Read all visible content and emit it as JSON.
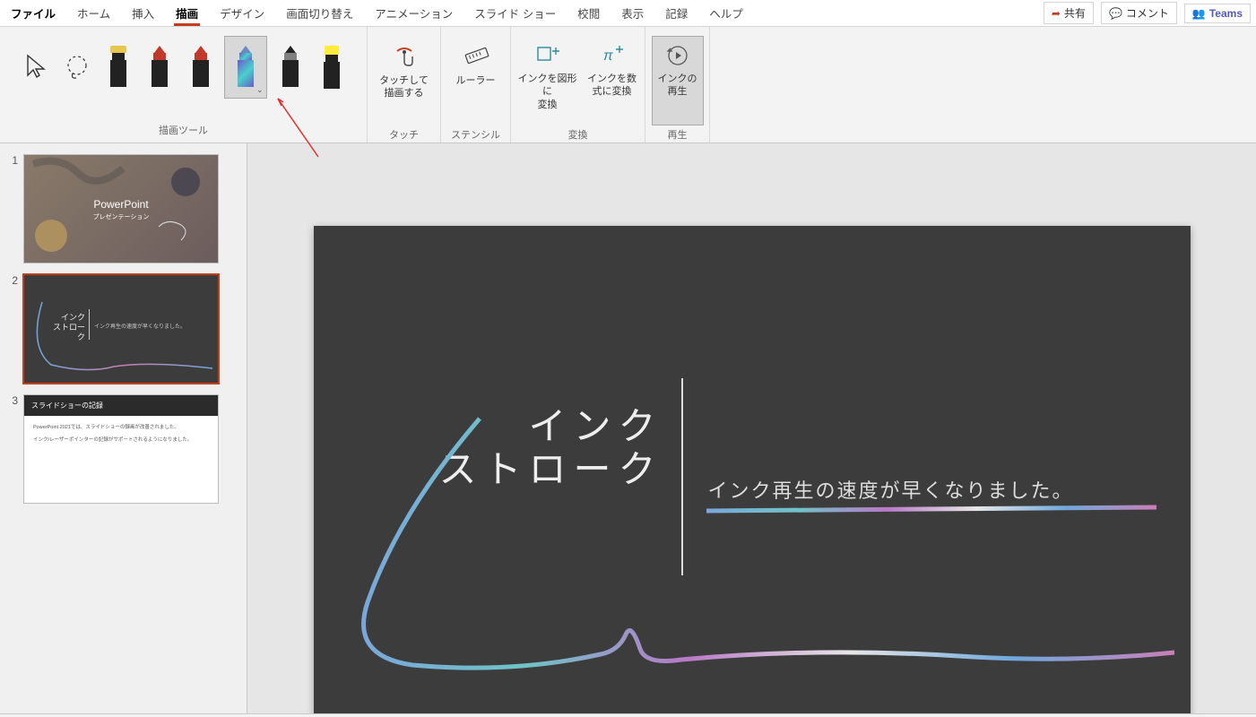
{
  "tabs": {
    "file": "ファイル",
    "home": "ホーム",
    "insert": "挿入",
    "draw": "描画",
    "design": "デザイン",
    "transition": "画面切り替え",
    "animation": "アニメーション",
    "slideshow": "スライド ショー",
    "review": "校閲",
    "view": "表示",
    "record": "記録",
    "help": "ヘルプ",
    "active": "draw"
  },
  "actions": {
    "share": "共有",
    "comment": "コメント",
    "teams": "Teams"
  },
  "ribbon": {
    "groups": {
      "drawtools": "描画ツール",
      "touch": "タッチ",
      "stencil": "ステンシル",
      "convert": "変換",
      "replay": "再生"
    },
    "touch_draw": "タッチして\n描画する",
    "ruler": "ルーラー",
    "ink_to_shape": "インクを図形に\n変換",
    "ink_to_math": "インクを数\n式に変換",
    "ink_replay": "インクの\n再生",
    "pens": {
      "p0": {
        "name": "select",
        "color": "#000"
      },
      "p1": {
        "name": "lasso",
        "color": "#000"
      },
      "p2": {
        "name": "highlighter-yellow",
        "color": "#e6c84f"
      },
      "p3": {
        "name": "pen-red",
        "color": "#c0392b"
      },
      "p4": {
        "name": "pen-red2",
        "color": "#c0392b"
      },
      "p5": {
        "name": "pen-galaxy",
        "color": "galaxy",
        "selected": true
      },
      "p6": {
        "name": "pencil-gray",
        "color": "#808080"
      },
      "p7": {
        "name": "highlighter-yellow2",
        "color": "#ffeb3b"
      }
    }
  },
  "thumbnails": [
    {
      "num": "1",
      "kind": "title",
      "title": "PowerPoint",
      "subtitle": "プレゼンテーション"
    },
    {
      "num": "2",
      "kind": "ink",
      "title": "インク\nストローク",
      "subtitle": "インク再生の速度が早くなりました。",
      "active": true
    },
    {
      "num": "3",
      "kind": "record",
      "title": "スライドショーの記録",
      "line1": "PowerPoint 2021では、スライドショーの録画が改善されました。",
      "line2": "インク/レーザーポインターの記録がサポートされるようになりました。"
    }
  ],
  "slide": {
    "title_line1": "インク",
    "title_line2": "ストローク",
    "subtitle": "インク再生の速度が早くなりました。"
  }
}
